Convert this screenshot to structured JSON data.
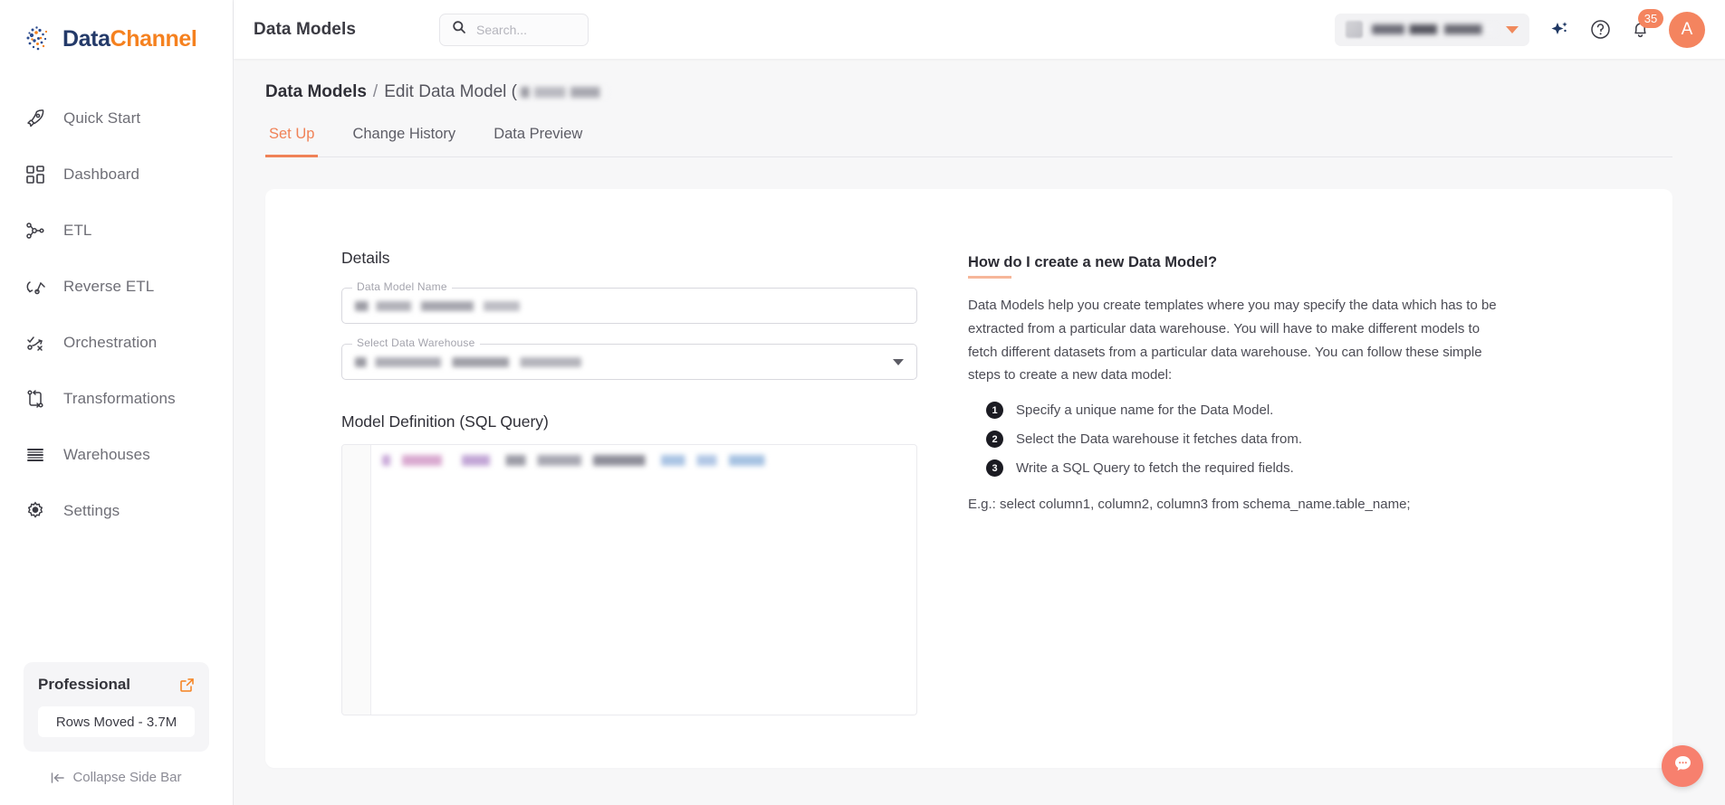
{
  "brand": {
    "name_part1": "Data",
    "name_part2": "Channel",
    "accent_orange": "#f5811f",
    "accent_navy": "#243a69"
  },
  "sidebar": {
    "items": [
      {
        "label": "Quick Start",
        "icon": "rocket-icon"
      },
      {
        "label": "Dashboard",
        "icon": "grid-icon"
      },
      {
        "label": "ETL",
        "icon": "etl-icon"
      },
      {
        "label": "Reverse ETL",
        "icon": "reverse-etl-icon"
      },
      {
        "label": "Orchestration",
        "icon": "orchestration-icon"
      },
      {
        "label": "Transformations",
        "icon": "transformations-icon"
      },
      {
        "label": "Warehouses",
        "icon": "warehouse-icon"
      },
      {
        "label": "Settings",
        "icon": "gear-icon"
      }
    ],
    "plan": {
      "name": "Professional",
      "rows_moved": "Rows Moved - 3.7M",
      "external_icon": "external-link-icon"
    },
    "collapse_label": "Collapse Side Bar"
  },
  "topbar": {
    "title": "Data Models",
    "search": {
      "placeholder": "Search...",
      "value": "",
      "icon": "search-icon"
    },
    "org_selector": {
      "value": "",
      "chevron": "chevron-down-icon"
    },
    "ai_icon": "sparkle-icon",
    "help_icon": "help-circle-icon",
    "notifications": {
      "icon": "bell-icon",
      "count": "35"
    },
    "avatar": {
      "initial": "A"
    }
  },
  "breadcrumb": {
    "root": "Data Models",
    "separator": "/",
    "current": "Edit Data Model (",
    "model_name_redacted": ""
  },
  "tabs": [
    {
      "label": "Set Up",
      "active": true
    },
    {
      "label": "Change History",
      "active": false
    },
    {
      "label": "Data Preview",
      "active": false
    }
  ],
  "form": {
    "section_title": "Details",
    "name_field": {
      "label": "Data Model Name",
      "value": ""
    },
    "warehouse_field": {
      "label": "Select Data Warehouse",
      "value": ""
    },
    "sql_title": "Model Definition (SQL Query)",
    "sql_value": ""
  },
  "help": {
    "title": "How do I create a new Data Model?",
    "paragraph": "Data Models help you create templates where you may specify the data which has to be extracted from a particular data warehouse. You will have to make different models to fetch different datasets from a particular data warehouse. You can follow these simple steps to create a new data model:",
    "steps": [
      {
        "num": "1",
        "text": "Specify a unique name for the Data Model."
      },
      {
        "num": "2",
        "text": "Select the Data warehouse it fetches data from."
      },
      {
        "num": "3",
        "text": "Write a SQL Query to fetch the required fields."
      }
    ],
    "example": "E.g.: select column1, column2, column3 from schema_name.table_name;"
  },
  "chat": {
    "icon": "chat-bubble-icon",
    "color": "#f7806e"
  }
}
